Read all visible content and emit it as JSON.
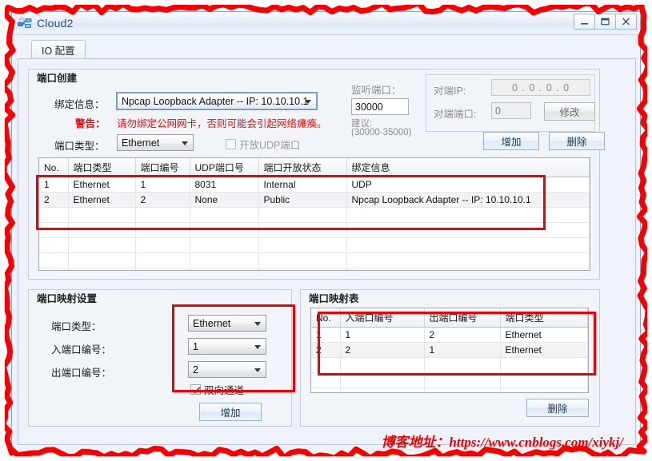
{
  "window": {
    "title": "Cloud2",
    "icon": "cloud-network-icon",
    "controls": {
      "minimize": "—",
      "maximize": "❐",
      "close": "X"
    }
  },
  "tabs": [
    {
      "label": "IO 配置",
      "selected": true
    }
  ],
  "port_create": {
    "group_title": "端口创建",
    "bind_label": "绑定信息：",
    "bind_value": "Npcap Loopback Adapter -- IP: 10.10.10.1",
    "warn_label": "警告：",
    "warn_text": "请勿绑定公网网卡，否则可能会引起网络瘫痪。",
    "port_type_label": "端口类型：",
    "port_type_value": "Ethernet",
    "udp_checkbox_label": "开放UDP端口",
    "udp_checkbox_checked": false,
    "listen_port_label": "监听端口：",
    "listen_port_value": "30000",
    "suggest_line1": "建议:",
    "suggest_line2": "(30000-35000)",
    "peer_ip_label": "对端IP:",
    "peer_ip_value": "0 . 0 . 0 . 0",
    "peer_port_label": "对端端口:",
    "peer_port_value": "0",
    "modify_button": "修改",
    "add_button": "增加",
    "delete_button": "删除"
  },
  "port_table": {
    "columns": [
      "No.",
      "端口类型",
      "端口编号",
      "UDP端口号",
      "端口开放状态",
      "绑定信息"
    ],
    "rows": [
      [
        "1",
        "Ethernet",
        "1",
        "8031",
        "Internal",
        "UDP"
      ],
      [
        "2",
        "Ethernet",
        "2",
        "None",
        "Public",
        "Npcap Loopback Adapter -- IP: 10.10.10.1"
      ]
    ],
    "empty_rows": 5
  },
  "map_settings": {
    "group_title": "端口映射设置",
    "port_type_label": "端口类型：",
    "port_type_value": "Ethernet",
    "in_port_label": "入端口编号：",
    "in_port_value": "1",
    "out_port_label": "出端口编号：",
    "out_port_value": "2",
    "bidirectional_label": "双向通道",
    "bidirectional_checked": true,
    "add_button": "增加"
  },
  "map_table": {
    "group_title": "端口映射表",
    "columns": [
      "No.",
      "入端口编号",
      "出端口编号",
      "端口类型"
    ],
    "rows": [
      [
        "1",
        "1",
        "2",
        "Ethernet"
      ],
      [
        "2",
        "2",
        "1",
        "Ethernet"
      ]
    ],
    "empty_rows": 3,
    "delete_button": "删除"
  },
  "watermark": {
    "text": "博客地址：https://www.cnblogs.com/xiykj/"
  },
  "colors": {
    "annotation_red": "#f00000",
    "warning_red": "#e01010",
    "title_blue": "#1f4e8c"
  }
}
